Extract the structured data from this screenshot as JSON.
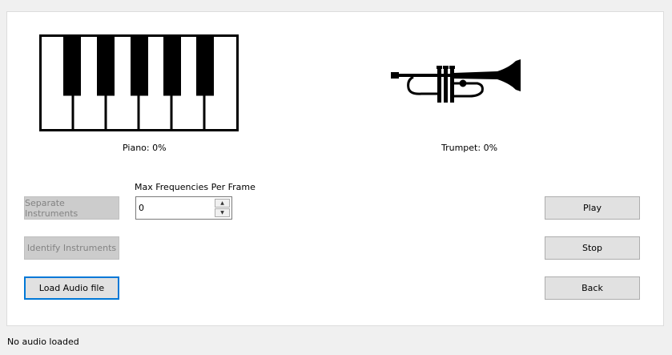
{
  "instruments": {
    "piano_label": "Piano: 0%",
    "trumpet_label": "Trumpet: 0%",
    "piano_image": "piano-keyboard-icon",
    "trumpet_image": "trumpet-icon"
  },
  "controls": {
    "separate_label": "Separate  Instruments",
    "identify_label": "Identify Instruments",
    "load_label": "Load Audio file",
    "max_freq_label": "Max Frequencies Per Frame",
    "max_freq_value": "0",
    "play_label": "Play",
    "stop_label": "Stop",
    "back_label": "Back"
  },
  "status": {
    "text": "No audio loaded"
  },
  "colors": {
    "window_bg": "#f0f0f0",
    "panel_bg": "#ffffff",
    "button_bg": "#e1e1e1",
    "button_disabled_bg": "#cccccc",
    "focus_border": "#0078d7"
  }
}
